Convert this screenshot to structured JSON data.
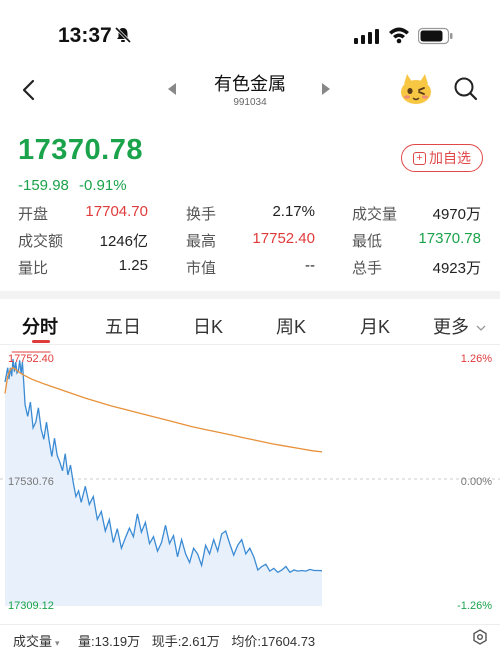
{
  "status": {
    "time": "13:37"
  },
  "header": {
    "title": "有色金属",
    "code": "991034"
  },
  "quote": {
    "price": "17370.78",
    "change": "-159.98",
    "change_pct": "-0.91%",
    "add_fav_label": "加自选"
  },
  "stats": [
    {
      "label": "开盘",
      "value": "17704.70",
      "color": "red"
    },
    {
      "label": "换手",
      "value": "2.17%",
      "color": ""
    },
    {
      "label": "成交量",
      "value": "4970万",
      "color": ""
    },
    {
      "label": "成交额",
      "value": "1246亿",
      "color": ""
    },
    {
      "label": "最高",
      "value": "17752.40",
      "color": "red"
    },
    {
      "label": "最低",
      "value": "17370.78",
      "color": "green"
    },
    {
      "label": "量比",
      "value": "1.25",
      "color": ""
    },
    {
      "label": "市值",
      "value": "--",
      "color": ""
    },
    {
      "label": "总手",
      "value": "4923万",
      "color": ""
    }
  ],
  "tabs": [
    "分时",
    "五日",
    "日K",
    "周K",
    "月K",
    "更多"
  ],
  "active_tab": 0,
  "chart_data": {
    "type": "line",
    "title": "",
    "y_left_labels": {
      "top": "17752.40",
      "mid": "17530.76",
      "bottom": "17309.12"
    },
    "y_right_labels": {
      "top": "1.26%",
      "mid": "0.00%",
      "bottom": "-1.26%"
    },
    "ylim": [
      17309.12,
      17752.4
    ],
    "prev_close": 17530.76,
    "x_range": [
      0,
      240
    ],
    "series": [
      {
        "color": "#3b8bd4",
        "x": [
          0,
          1,
          2,
          3,
          4,
          5,
          6,
          7,
          8,
          9,
          10,
          11,
          12,
          13,
          14,
          15,
          17,
          19,
          21,
          23,
          25,
          27,
          29,
          31,
          33,
          35,
          37,
          39,
          41,
          43,
          45,
          47,
          49,
          51,
          53,
          55,
          57,
          60,
          63,
          66,
          69,
          72,
          75,
          78,
          81,
          84,
          87,
          90,
          93,
          96,
          99,
          102,
          105,
          108,
          111,
          114,
          117,
          120,
          123,
          126,
          129,
          132,
          135,
          138,
          141,
          144,
          147,
          150,
          153,
          156,
          159,
          162,
          165,
          168,
          171,
          174,
          177,
          180,
          183,
          186,
          189,
          192,
          195,
          198,
          201,
          204,
          207,
          210,
          213,
          216,
          219,
          222,
          225,
          228,
          231,
          234,
          237
        ],
        "values": [
          17700,
          17712,
          17725,
          17705,
          17725,
          17710,
          17740,
          17718,
          17735,
          17716,
          17720,
          17738,
          17715,
          17735,
          17700,
          17660,
          17640,
          17665,
          17620,
          17630,
          17655,
          17618,
          17600,
          17630,
          17598,
          17570,
          17602,
          17572,
          17560,
          17545,
          17575,
          17538,
          17555,
          17525,
          17500,
          17510,
          17490,
          17518,
          17486,
          17500,
          17460,
          17474,
          17440,
          17460,
          17420,
          17444,
          17410,
          17428,
          17445,
          17430,
          17470,
          17438,
          17455,
          17418,
          17430,
          17405,
          17420,
          17450,
          17418,
          17432,
          17395,
          17425,
          17400,
          17385,
          17410,
          17400,
          17380,
          17415,
          17400,
          17425,
          17405,
          17435,
          17440,
          17418,
          17398,
          17415,
          17425,
          17400,
          17410,
          17395,
          17372,
          17378,
          17382,
          17370,
          17375,
          17368,
          17372,
          17378,
          17368,
          17372,
          17370,
          17371,
          17370,
          17373,
          17371,
          17371,
          17370.78
        ]
      },
      {
        "color": "#e8913a",
        "x": [
          0,
          2,
          4,
          6,
          8,
          10,
          14,
          20,
          30,
          40,
          50,
          60,
          70,
          80,
          90,
          100,
          110,
          120,
          130,
          140,
          150,
          160,
          170,
          180,
          190,
          200,
          210,
          220,
          230,
          237
        ],
        "values": [
          17680,
          17710,
          17722,
          17725,
          17722,
          17718,
          17712,
          17705,
          17696,
          17688,
          17680,
          17672,
          17665,
          17658,
          17652,
          17646,
          17640,
          17634,
          17628,
          17622,
          17617,
          17612,
          17607,
          17602,
          17597,
          17592,
          17588,
          17584,
          17580,
          17578
        ]
      }
    ]
  },
  "footer": {
    "selector": "成交量",
    "volume": "量:13.19万",
    "current": "现手:2.61万",
    "avg": "均价:17604.73"
  }
}
